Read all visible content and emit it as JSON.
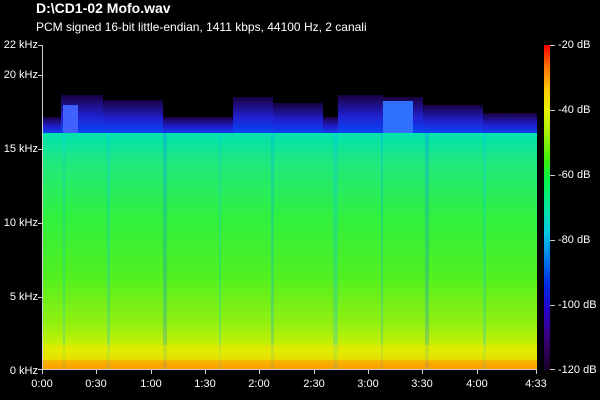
{
  "header": {
    "title": "D:\\CD1-02 Mofo.wav",
    "subtitle": "PCM signed 16-bit little-endian, 1411 kbps, 44100 Hz, 2 canali"
  },
  "y_axis": {
    "labels": [
      "22 kHz",
      "20 kHz",
      "15 kHz",
      "10 kHz",
      "5 kHz",
      "0 kHz"
    ]
  },
  "x_axis": {
    "labels": [
      "0:00",
      "0:30",
      "1:00",
      "1:30",
      "2:00",
      "2:30",
      "3:00",
      "3:30",
      "4:00",
      "4:33"
    ]
  },
  "colorbar": {
    "labels": [
      "-20 dB",
      "-40 dB",
      "-60 dB",
      "-80 dB",
      "-100 dB",
      "-120 dB"
    ]
  },
  "colors": {
    "background": "#000000",
    "cutoff_band": "#0000ff",
    "body": "#22ee44",
    "bass": "#e8f000"
  }
}
